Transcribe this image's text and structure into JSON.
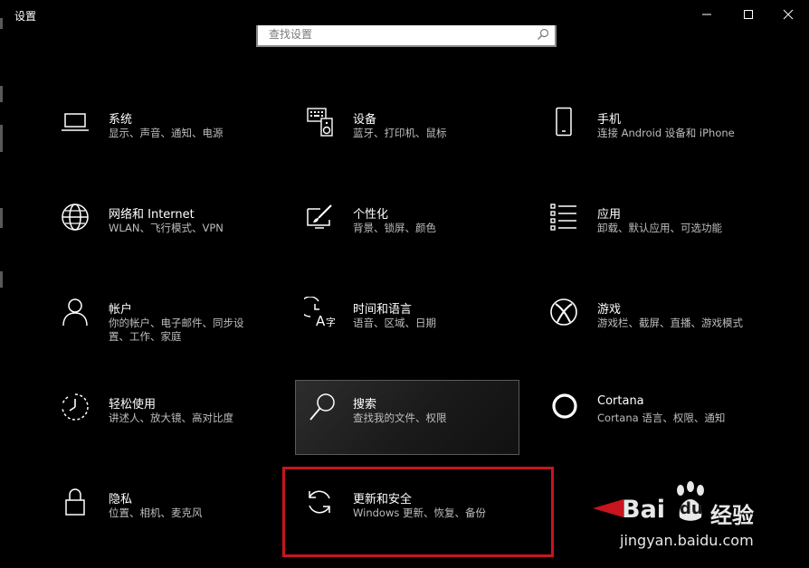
{
  "window": {
    "title": "设置",
    "minimize_icon": "minimize-icon",
    "maximize_icon": "maximize-icon",
    "close_icon": "close-icon"
  },
  "search": {
    "placeholder": "查找设置",
    "icon": "search-icon"
  },
  "tiles": [
    {
      "title": "系统",
      "subtitle": "显示、声音、通知、电源",
      "icon": "laptop-icon"
    },
    {
      "title": "设备",
      "subtitle": "蓝牙、打印机、鼠标",
      "icon": "keyboard-speaker-icon"
    },
    {
      "title": "手机",
      "subtitle": "连接 Android 设备和 iPhone",
      "icon": "phone-icon"
    },
    {
      "title": "网络和 Internet",
      "subtitle": "WLAN、飞行模式、VPN",
      "icon": "globe-icon"
    },
    {
      "title": "个性化",
      "subtitle": "背景、锁屏、颜色",
      "icon": "paintbrush-icon"
    },
    {
      "title": "应用",
      "subtitle": "卸载、默认应用、可选功能",
      "icon": "apps-list-icon"
    },
    {
      "title": "帐户",
      "subtitle": "你的帐户、电子邮件、同步设置、工作、家庭",
      "icon": "person-icon"
    },
    {
      "title": "时间和语言",
      "subtitle": "语音、区域、日期",
      "icon": "time-language-icon"
    },
    {
      "title": "游戏",
      "subtitle": "游戏栏、截屏、直播、游戏模式",
      "icon": "xbox-icon"
    },
    {
      "title": "轻松使用",
      "subtitle": "讲述人、放大镜、高对比度",
      "icon": "ease-of-access-icon"
    },
    {
      "title": "搜索",
      "subtitle": "查找我的文件、权限",
      "icon": "magnifier-icon"
    },
    {
      "title": "Cortana",
      "subtitle": "Cortana 语言、权限、通知",
      "icon": "cortana-ring-icon"
    },
    {
      "title": "隐私",
      "subtitle": "位置、相机、麦克风",
      "icon": "lock-icon"
    },
    {
      "title": "更新和安全",
      "subtitle": "Windows 更新、恢复、备份",
      "icon": "sync-icon"
    }
  ],
  "watermark": {
    "brand": "Bai",
    "brand_tail": "du",
    "suffix": "经验",
    "url": "jingyan.baidu.com"
  },
  "colors": {
    "background": "#000000",
    "highlight_border": "#c8141e",
    "hover_border": "#5a5a5a",
    "subtitle": "#bdbdbd"
  }
}
